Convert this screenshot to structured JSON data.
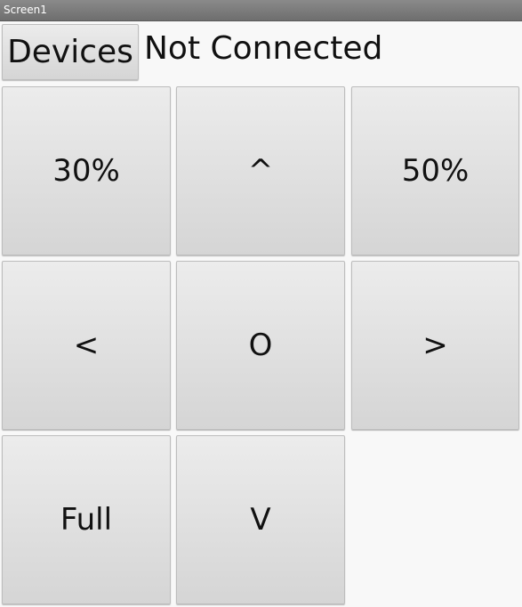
{
  "window": {
    "title": "Screen1"
  },
  "header": {
    "devices_label": "Devices",
    "status_text": "Not Connected"
  },
  "controls": {
    "btn_30": "30%",
    "btn_up": "^",
    "btn_50": "50%",
    "btn_left": "<",
    "btn_stop": "O",
    "btn_right": ">",
    "btn_full": "Full",
    "btn_down": "V"
  },
  "colors": {
    "button_top": "#ececec",
    "button_bottom": "#d5d5d5",
    "background": "#f8f8f8",
    "titlebar": "#7a7a7a"
  }
}
